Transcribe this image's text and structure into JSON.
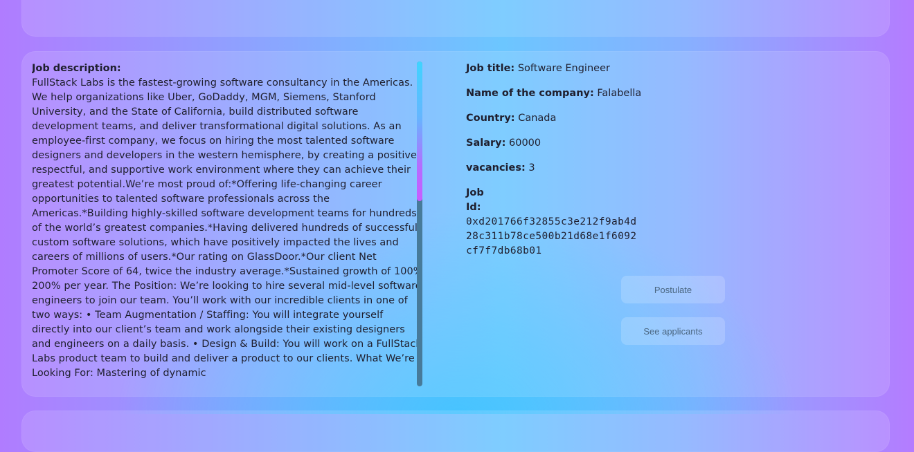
{
  "description": {
    "label": "Job description:",
    "text": "FullStack Labs is the fastest-growing software consultancy in the Americas. We help organizations like Uber, GoDaddy, MGM, Siemens, Stanford University, and the State of California, build distributed software development teams, and deliver transformational digital solutions. As an employee-first company, we focus on hiring the most talented software designers and developers in the western hemisphere, by creating a positive, respectful, and supportive work environment where they can achieve their greatest potential.We’re most proud of:*Offering life-changing career opportunities to talented software professionals across the Americas.*Building highly-skilled software development teams for hundreds of the world’s greatest companies.*Having delivered hundreds of successful custom software solutions, which have positively impacted the lives and careers of millions of users.*Our rating on GlassDoor.*Our client Net Promoter Score of 64, twice the industry average.*Sustained growth of 100% 200% per year. The Position: We’re looking to hire several mid-level software engineers to join our team. You’ll work with our incredible clients in one of two ways: • Team Augmentation / Staffing: You will integrate yourself directly into our client’s team and work alongside their existing designers and engineers on a daily basis. • Design & Build: You will work on a FullStack Labs product team to build and deliver a product to our clients. What We’re Looking For: Mastering of dynamic"
  },
  "details": {
    "job_title_label": "Job title:",
    "job_title": "Software Engineer",
    "company_label": "Name of the company:",
    "company": "Falabella",
    "country_label": "Country:",
    "country": "Canada",
    "salary_label": "Salary:",
    "salary": "60000",
    "vacancies_label": "vacancies:",
    "vacancies": "3",
    "job_id_label": "Job Id:",
    "job_id": "0xd201766f32855c3e212f9ab4d28c311b78ce500b21d68e1f6092cf7f7db68b01"
  },
  "buttons": {
    "postulate": "Postulate",
    "see_applicants": "See applicants"
  },
  "scroll": {
    "position_fraction": 0.0,
    "visible_fraction": 0.43
  }
}
